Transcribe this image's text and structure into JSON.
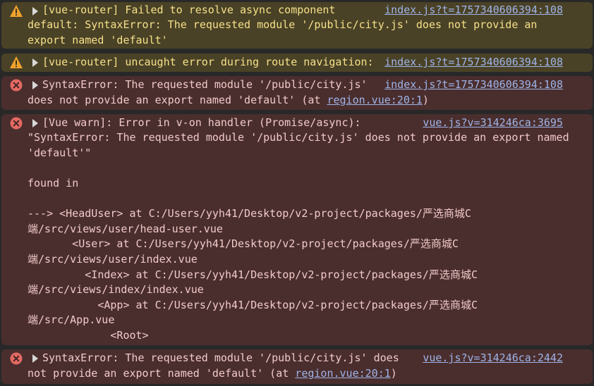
{
  "messages": [
    {
      "level": "warning",
      "icon": "warning-icon",
      "source": "index.js?t=1757340606394:108",
      "lines": [
        "[vue-router] Failed to resolve async component",
        "default: SyntaxError: The requested module '/public/city.js' does not provide an",
        "export named 'default'"
      ]
    },
    {
      "level": "warning",
      "icon": "warning-icon",
      "source": "index.js?t=1757340606394:108",
      "lines": [
        "[vue-router] uncaught error during route navigation:"
      ]
    },
    {
      "level": "error",
      "icon": "error-icon",
      "source": "index.js?t=1757340606394:108",
      "lines": [
        "SyntaxError: The requested module '/public/city.js'",
        "does not provide an export named 'default' (at "
      ],
      "link": "region.vue:20:1",
      "tail": ")"
    },
    {
      "level": "error",
      "icon": "error-icon",
      "source": "vue.js?v=314246ca:3695",
      "lines": [
        "[Vue warn]: Error in v-on handler (Promise/async):",
        "\"SyntaxError: The requested module '/public/city.js' does not provide an export named",
        "'default'\"",
        "",
        "found in",
        "",
        "---> <HeadUser> at C:/Users/yyh41/Desktop/v2-project/packages/严选商城C",
        "端/src/views/user/head-user.vue",
        "       <User> at C:/Users/yyh41/Desktop/v2-project/packages/严选商城C",
        "端/src/views/user/index.vue",
        "         <Index> at C:/Users/yyh41/Desktop/v2-project/packages/严选商城C",
        "端/src/views/index/index.vue",
        "           <App> at C:/Users/yyh41/Desktop/v2-project/packages/严选商城C",
        "端/src/App.vue",
        "             <Root>"
      ]
    },
    {
      "level": "error",
      "icon": "error-icon",
      "source": "vue.js?v=314246ca:2442",
      "lines": [
        "SyntaxError: The requested module '/public/city.js' does",
        "not provide an export named 'default' (at "
      ],
      "link": "region.vue:20:1",
      "tail": ")"
    }
  ]
}
